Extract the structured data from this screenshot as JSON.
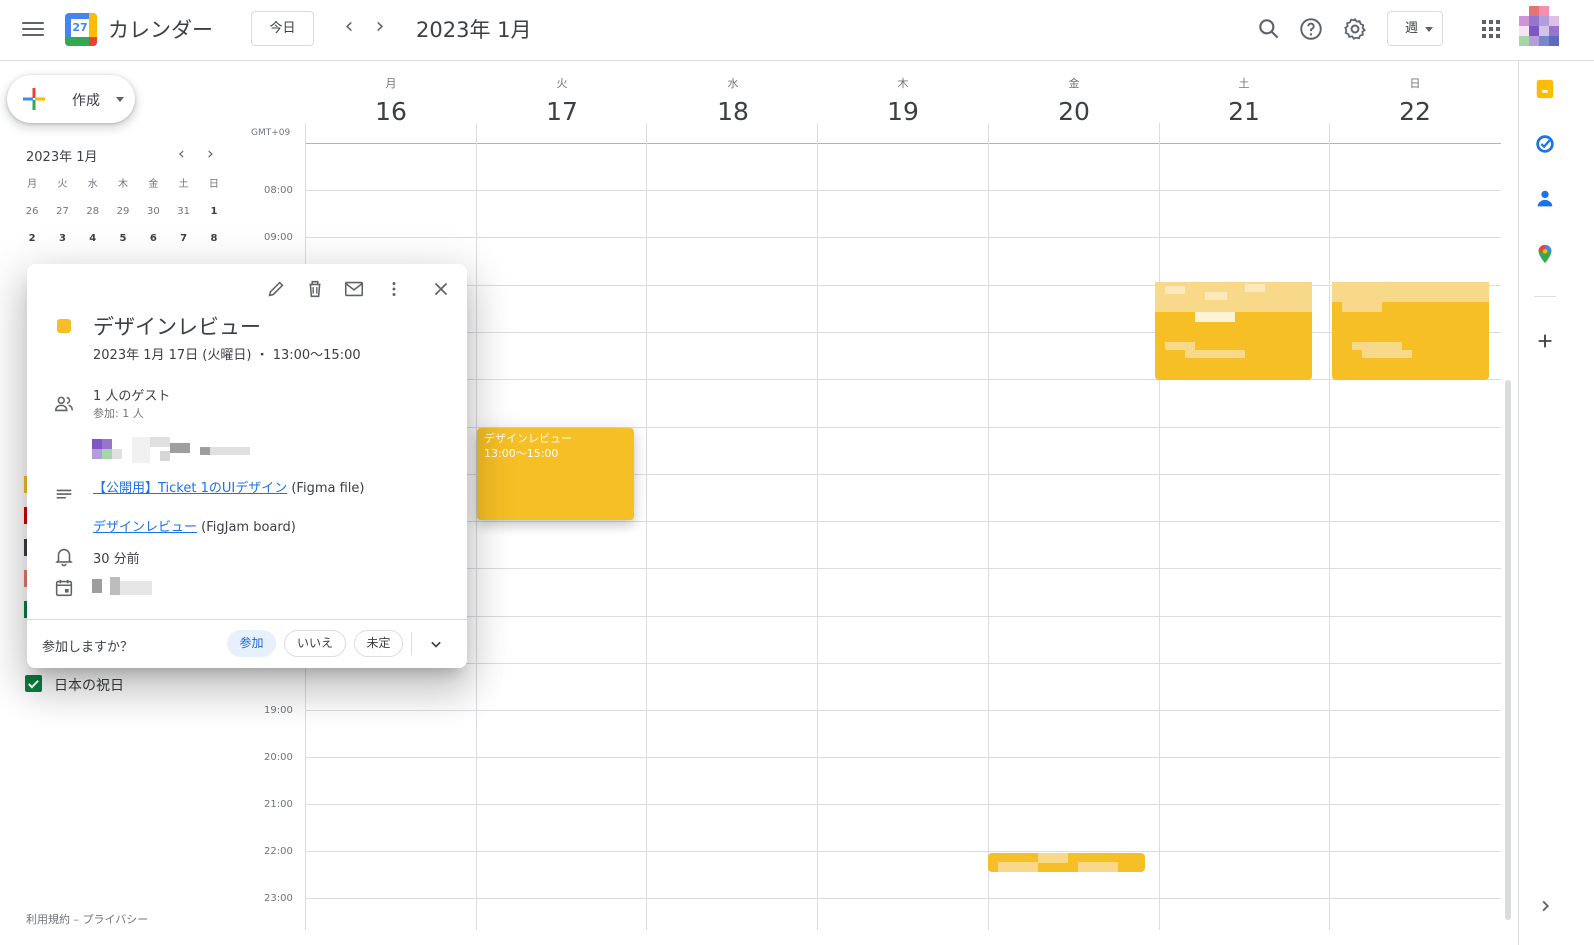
{
  "header": {
    "app_title": "カレンダー",
    "logo_day": "27",
    "today_label": "今日",
    "prev": "‹",
    "next": "›",
    "date_title": "2023年 1月",
    "view_label": "週"
  },
  "sidebar": {
    "create_label": "作成",
    "mini_title": "2023年 1月",
    "mini_prev": "‹",
    "mini_next": "›",
    "mini_headers": [
      "月",
      "火",
      "水",
      "木",
      "金",
      "土",
      "日"
    ],
    "mini_rows": [
      [
        "26",
        "27",
        "28",
        "29",
        "30",
        "31",
        "1"
      ],
      [
        "2",
        "3",
        "4",
        "5",
        "6",
        "7",
        "8"
      ]
    ],
    "calendar_colors": [
      "#f6bf26",
      "#d50000",
      "#3c4043",
      "#e67c73",
      "#0b8043"
    ],
    "holiday_label": "日本の祝日",
    "footer": "利用規約 – プライバシー"
  },
  "week": {
    "tz": "GMT+09",
    "days": [
      {
        "dow": "月",
        "num": "16"
      },
      {
        "dow": "火",
        "num": "17"
      },
      {
        "dow": "水",
        "num": "18"
      },
      {
        "dow": "木",
        "num": "19"
      },
      {
        "dow": "金",
        "num": "20"
      },
      {
        "dow": "土",
        "num": "21"
      },
      {
        "dow": "日",
        "num": "22"
      }
    ],
    "times": [
      "08:00",
      "09:00",
      "19:00",
      "20:00",
      "21:00",
      "22:00",
      "23:00"
    ]
  },
  "event": {
    "title": "デザインレビュー",
    "time": "13:00〜15:00",
    "color": "#f6bf26"
  },
  "popup": {
    "title": "デザインレビュー",
    "when": "2023年 1月 17日 (火曜日) ・ 13:00〜15:00",
    "guests": "1 人のゲスト",
    "guests_sub": "参加: 1 人",
    "desc1_link": "【公開用】Ticket 1のUIデザイン",
    "desc1_suffix": " (Figma file)",
    "desc2_link": "デザインレビュー",
    "desc2_suffix": " (FigJam board)",
    "reminder": "30 分前",
    "rsvp_question": "参加しますか？",
    "rsvp_yes": "参加",
    "rsvp_no": "いいえ",
    "rsvp_maybe": "未定"
  },
  "icons": {
    "menu": "menu-icon",
    "search": "search-icon",
    "help": "help-icon",
    "settings": "gear-icon",
    "apps": "apps-grid-icon",
    "edit": "pencil-icon",
    "delete": "trash-icon",
    "email": "mail-icon",
    "more": "more-vert-icon",
    "close": "close-icon"
  }
}
